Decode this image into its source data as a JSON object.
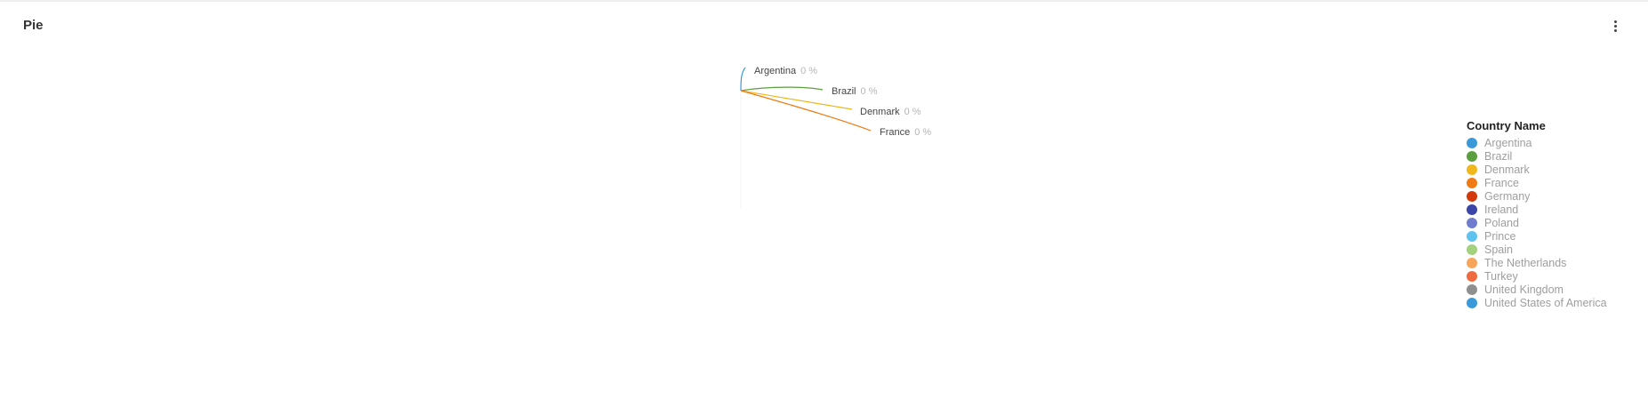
{
  "card": {
    "title": "Pie",
    "menu_icon": "more-vertical-icon"
  },
  "chart_data": {
    "type": "pie",
    "categories": [
      "Argentina",
      "Brazil",
      "Denmark",
      "France",
      "Germany",
      "Ireland",
      "Poland",
      "Prince",
      "Spain",
      "The Netherlands",
      "Turkey",
      "United Kingdom",
      "United States of America"
    ],
    "values": [
      0,
      0,
      0,
      0,
      0,
      0,
      0,
      0,
      0,
      0,
      0,
      0,
      0
    ],
    "colors": [
      "#3a9ad9",
      "#5a9e3e",
      "#f0b81c",
      "#f07a14",
      "#d4380d",
      "#3b44a8",
      "#6f7ccf",
      "#5ec3ee",
      "#a3d17e",
      "#f6a55a",
      "#ef6a3f",
      "#8f8f8f",
      "#3a9ad9"
    ],
    "data_labels": [
      {
        "name": "Argentina",
        "value": "0 %"
      },
      {
        "name": "Brazil",
        "value": "0 %"
      },
      {
        "name": "Denmark",
        "value": "0 %"
      },
      {
        "name": "France",
        "value": "0 %"
      }
    ],
    "legend": {
      "title": "Country Name",
      "position": "right"
    }
  }
}
